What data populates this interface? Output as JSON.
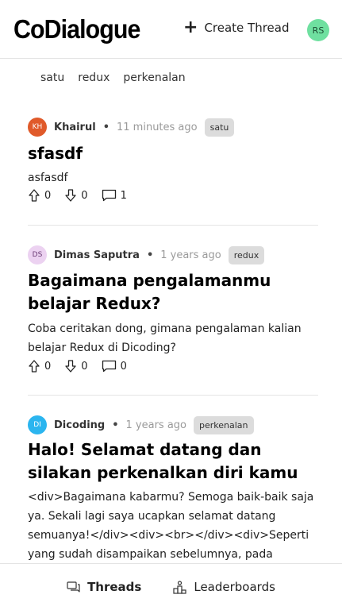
{
  "header": {
    "logo": "CoDialogue",
    "create_thread_label": "Create Thread",
    "user_initials": "RS"
  },
  "categories": [
    "satu",
    "redux",
    "perkenalan"
  ],
  "threads": [
    {
      "avatar_initials": "KH",
      "avatar_color": "#e05a2a",
      "author": "Khairul",
      "time": "11 minutes ago",
      "tag": "satu",
      "title": "sfasdf",
      "body": "asfasdf",
      "upvotes": "0",
      "downvotes": "0",
      "comments": "1"
    },
    {
      "avatar_initials": "DS",
      "avatar_color": "#e9c6ef",
      "author": "Dimas Saputra",
      "time": "1 years ago",
      "tag": "redux",
      "title": "Bagaimana pengalamanmu belajar Redux?",
      "body": "Coba ceritakan dong, gimana pengalaman kalian belajar Redux di Dicoding?",
      "upvotes": "0",
      "downvotes": "0",
      "comments": "0"
    },
    {
      "avatar_initials": "DI",
      "avatar_color": "#2bb5ef",
      "author": "Dicoding",
      "time": "1 years ago",
      "tag": "perkenalan",
      "title": "Halo! Selamat datang dan silakan perkenalkan diri kamu",
      "body": "<div>Bagaimana kabarmu? Semoga baik-baik saja ya. Sekali lagi saya ucapkan selamat datang semuanya!</div><div><br></div><div>Seperti yang sudah disampaikan sebelumnya, pada",
      "upvotes": "0",
      "downvotes": "0",
      "comments": "0"
    }
  ],
  "bottom_nav": {
    "threads_label": "Threads",
    "leaderboards_label": "Leaderboards"
  }
}
